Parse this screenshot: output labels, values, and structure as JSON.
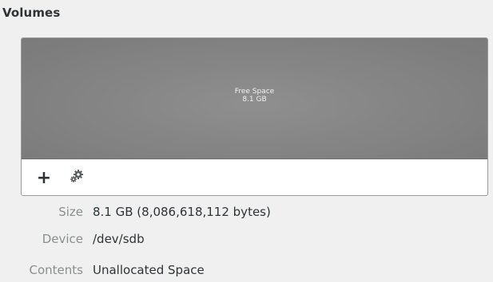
{
  "section": {
    "title": "Volumes"
  },
  "volume": {
    "label": "Free Space",
    "size": "8.1 GB"
  },
  "toolbar": {
    "add_icon": "plus-icon",
    "settings_icon": "gears-icon"
  },
  "properties": {
    "size_label": "Size",
    "size_value": "8.1 GB (8,086,618,112 bytes)",
    "device_label": "Device",
    "device_value": "/dev/sdb",
    "contents_label": "Contents",
    "contents_value": "Unallocated Space"
  }
}
